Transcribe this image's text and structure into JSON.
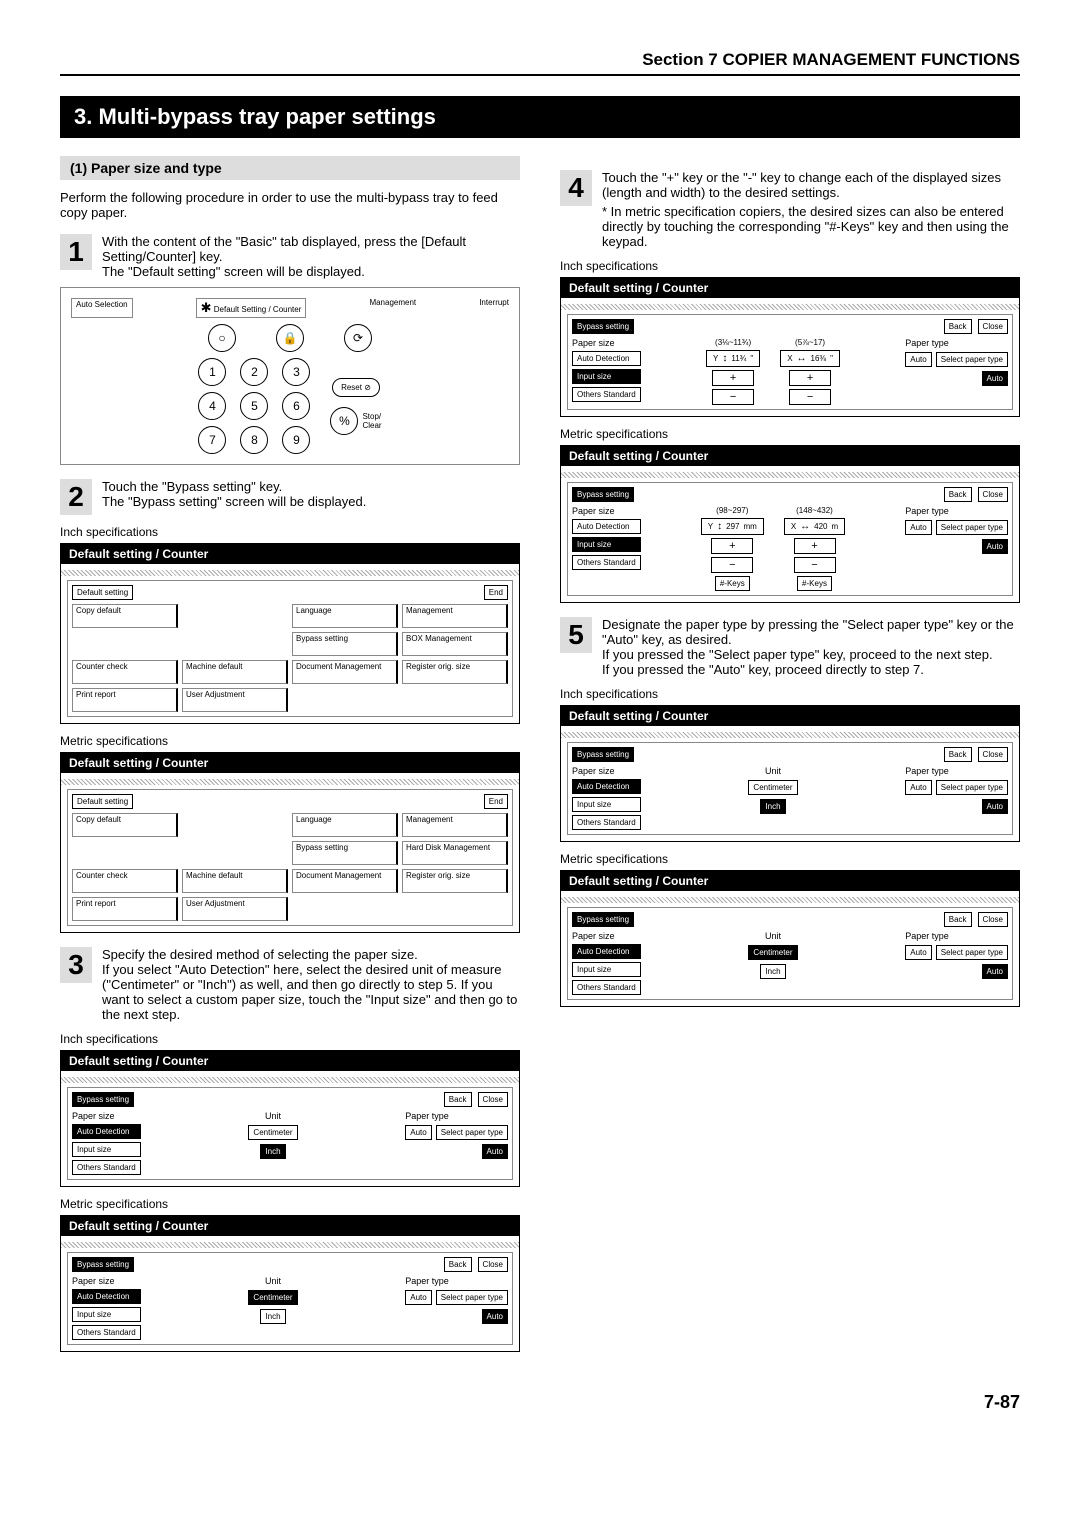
{
  "header": "Section 7  COPIER MANAGEMENT FUNCTIONS",
  "title": "3.   Multi-bypass tray paper settings",
  "subhead": "(1)  Paper size and type",
  "intro": "Perform the following procedure in order to use the multi-bypass tray to feed copy paper.",
  "steps": {
    "s1": "With the content of the \"Basic\" tab displayed, press the [Default Setting/Counter] key.\nThe \"Default setting\" screen will be displayed.",
    "s2": "Touch the \"Bypass setting\" key.\nThe \"Bypass setting\" screen will be displayed.",
    "s3": "Specify the desired method of selecting the paper size.\nIf you select \"Auto Detection\" here, select the desired unit of measure (\"Centimeter\" or \"Inch\") as well, and then go directly to step 5. If you want to select a custom paper size, touch the \"Input size\" and then go to the next step.",
    "s4": "Touch the \"+\" key or the \"-\" key to change each of the displayed sizes (length and width) to the desired settings.",
    "s4_note": "* In metric specification copiers, the desired sizes can also be entered directly by touching the corresponding \"#-Keys\" key and then using the keypad.",
    "s5": "Designate the paper type by pressing the \"Select paper type\" key or the \"Auto\" key, as desired.\nIf you pressed the \"Select paper type\" key, proceed to the next step.\nIf you pressed the \"Auto\" key, proceed directly to step 7."
  },
  "captions": {
    "inch": "Inch specifications",
    "metric": "Metric specifications"
  },
  "panel_title": "Default setting / Counter",
  "kp": {
    "auto_sel": "Auto Selection",
    "def": "Default Setting / Counter",
    "mgmt": "Management",
    "interrupt": "Interrupt",
    "reset": "Reset",
    "stopclear": "Stop/\nClear",
    "pct": "%"
  },
  "settings": {
    "tab": "Default setting",
    "end": "End",
    "cells_inch": [
      "Copy default",
      "",
      "Language",
      "Management",
      "",
      "",
      "Bypass setting",
      "BOX Management",
      "Counter check",
      "Machine default",
      "Document Management",
      "Register orig. size",
      "Print report",
      "User Adjustment"
    ],
    "cells_metric": [
      "Copy default",
      "",
      "Language",
      "Management",
      "",
      "",
      "Bypass setting",
      "Hard Disk Management",
      "Counter check",
      "Machine default",
      "Document Management",
      "Register orig. size",
      "Print report",
      "User Adjustment"
    ]
  },
  "bypass": {
    "tab": "Bypass setting",
    "back": "Back",
    "close": "Close",
    "paper_size": "Paper size",
    "unit": "Unit",
    "paper_type": "Paper type",
    "auto_det": "Auto Detection",
    "input_size": "Input size",
    "others": "Others Standard",
    "cm": "Centimeter",
    "inch": "Inch",
    "auto": "Auto",
    "select_pt": "Select paper type",
    "plus": "+",
    "minus": "−",
    "hash": "#-Keys"
  },
  "sizes": {
    "inch": {
      "y_range": "(3⅛~11¾)",
      "x_range": "(5⅞~17)",
      "y_val": "11¾",
      "x_val": "16⅜",
      "y_prefix": "Y",
      "x_prefix": "X",
      "y_unit": "\"",
      "x_unit": "\""
    },
    "metric": {
      "y_range": "(98~297)",
      "x_range": "(148~432)",
      "y_val": "297",
      "x_val": "420",
      "y_prefix": "Y",
      "x_prefix": "X",
      "y_unit": "mm",
      "x_unit": "m"
    }
  },
  "page_num": "7-87"
}
